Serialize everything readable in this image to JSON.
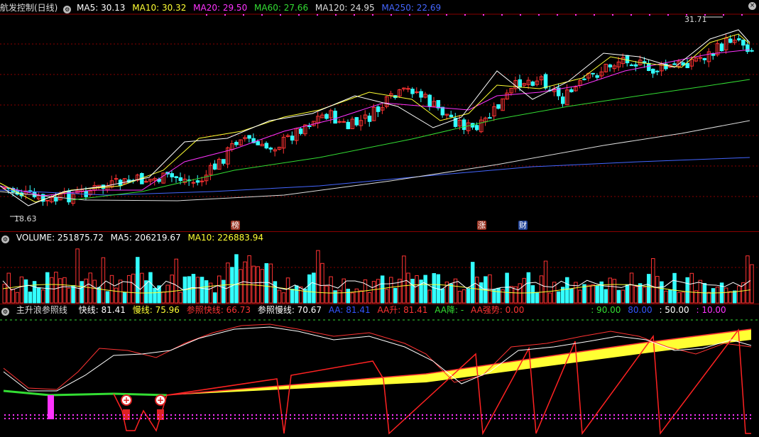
{
  "price": {
    "title": "航发控制(日线)",
    "ma": [
      {
        "label": "MA5: 30.13",
        "color": "#ffffff"
      },
      {
        "label": "MA10: 30.32",
        "color": "#ffff33"
      },
      {
        "label": "MA20: 29.50",
        "color": "#ff33ff"
      },
      {
        "label": "MA60: 27.66",
        "color": "#33dd33"
      },
      {
        "label": "MA120: 24.95",
        "color": "#dddddd"
      },
      {
        "label": "MA250: 22.69",
        "color": "#4466ff"
      }
    ],
    "high_label": "31.71",
    "low_label": "18.63",
    "tags": [
      {
        "text": "榜",
        "color": "#cc3333"
      },
      {
        "text": "涨",
        "color": "#cc3333"
      },
      {
        "text": "财",
        "color": "#2255cc"
      }
    ]
  },
  "volume": {
    "title": "VOLUME: 251875.72",
    "ma": [
      {
        "label": "MA5: 206219.67",
        "color": "#ffffff"
      },
      {
        "label": "MA10: 226883.94",
        "color": "#ffff33"
      }
    ]
  },
  "indicator": {
    "title": "主升浪参照线",
    "values": [
      {
        "label": "快线: 81.41",
        "color": "#ffffff"
      },
      {
        "label": "慢线: 75.96",
        "color": "#ffff33"
      },
      {
        "label": "参照快线: 66.73",
        "color": "#ff3333"
      },
      {
        "label": "参照慢线: 70.67",
        "color": "#ffffff"
      },
      {
        "label": "AA: 81.41",
        "color": "#3355ff"
      },
      {
        "label": "AA升: 81.41",
        "color": "#ff3333"
      },
      {
        "label": "AA降: -",
        "color": "#33dd33"
      },
      {
        "label": "AA强势: 0.00",
        "color": "#ff3333"
      },
      {
        "label": ": 90.00",
        "color": "#33dd33"
      },
      {
        "label": "80.00",
        "color": "#3355ff"
      },
      {
        "label": ": 50.00",
        "color": "#ffffff"
      },
      {
        "label": ": 10.00",
        "color": "#ff33ff"
      }
    ]
  },
  "colors": {
    "up": "#ff3333",
    "down": "#33ffff",
    "grid": "#8a0000",
    "background": "#000000"
  },
  "icons": [
    "gear-icon",
    "close-icon"
  ]
}
